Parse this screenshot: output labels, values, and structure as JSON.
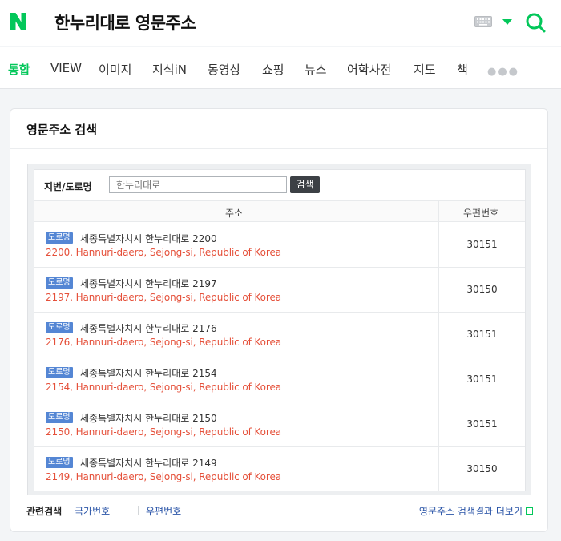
{
  "header": {
    "query": "한누리대로 영문주소"
  },
  "colors": {
    "brand": "#03c75a",
    "link": "#2c56a8",
    "english_address": "#e5503a",
    "badge": "#5486d4"
  },
  "tabs": [
    {
      "label": "통합",
      "active": true
    },
    {
      "label": "VIEW"
    },
    {
      "label": "이미지"
    },
    {
      "label": "지식iN"
    },
    {
      "label": "동영상"
    },
    {
      "label": "쇼핑"
    },
    {
      "label": "뉴스"
    },
    {
      "label": "어학사전"
    },
    {
      "label": "지도"
    },
    {
      "label": "책"
    }
  ],
  "card": {
    "title": "영문주소 검색",
    "search_label": "지번/도로명",
    "search_placeholder": "한누리대로",
    "search_button": "검색",
    "col_address": "주소",
    "col_zip": "우편번호",
    "rows": [
      {
        "badge": "도로명",
        "kor": "세종특별자치시 한누리대로 2200",
        "eng": "2200, Hannuri-daero, Sejong-si, Republic of Korea",
        "zip": "30151"
      },
      {
        "badge": "도로명",
        "kor": "세종특별자치시 한누리대로 2197",
        "eng": "2197, Hannuri-daero, Sejong-si, Republic of Korea",
        "zip": "30150"
      },
      {
        "badge": "도로명",
        "kor": "세종특별자치시 한누리대로 2176",
        "eng": "2176, Hannuri-daero, Sejong-si, Republic of Korea",
        "zip": "30151"
      },
      {
        "badge": "도로명",
        "kor": "세종특별자치시 한누리대로 2154",
        "eng": "2154, Hannuri-daero, Sejong-si, Republic of Korea",
        "zip": "30151"
      },
      {
        "badge": "도로명",
        "kor": "세종특별자치시 한누리대로 2150",
        "eng": "2150, Hannuri-daero, Sejong-si, Republic of Korea",
        "zip": "30151"
      },
      {
        "badge": "도로명",
        "kor": "세종특별자치시 한누리대로 2149",
        "eng": "2149, Hannuri-daero, Sejong-si, Republic of Korea",
        "zip": "30150"
      }
    ],
    "footer": {
      "related_label": "관련검색",
      "related_links": [
        "국가번호",
        "우편번호"
      ],
      "more_label": "영문주소 검색결과 더보기"
    }
  }
}
